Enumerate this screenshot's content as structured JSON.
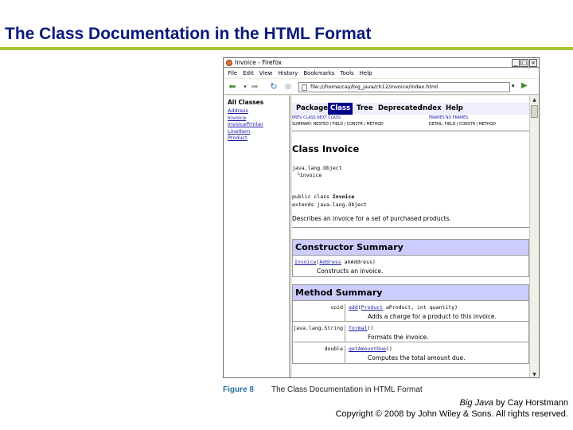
{
  "slide": {
    "title": "The Class Documentation in the HTML Format"
  },
  "browser": {
    "window_title": "Invoice - Firefox",
    "window_buttons": [
      "_",
      "□",
      "×"
    ],
    "menu": [
      "File",
      "Edit",
      "View",
      "History",
      "Bookmarks",
      "Tools",
      "Help"
    ],
    "nav_icons": [
      "back-arrow-icon",
      "forward-arrow-icon",
      "reload-icon",
      "stop-icon",
      "home-icon"
    ],
    "url": "file:///home/cay/big_java/ch12/invoice/index.html",
    "left_frame": {
      "heading": "All Classes",
      "classes": [
        "Address",
        "Invoice",
        "InvoicePrinter",
        "LineItem",
        "Product"
      ]
    },
    "content": {
      "nav_tabs": [
        "Package",
        "Class",
        "Tree",
        "Deprecated",
        "Index",
        "Help"
      ],
      "active_tab": "Class",
      "subnav_left_1": "PREV CLASS   NEXT CLASS",
      "subnav_left_2": "SUMMARY: NESTED | FIELD | CONSTR | METHOD",
      "subnav_right_1": "FRAMES   NO FRAMES",
      "subnav_right_2": "DETAIL: FIELD | CONSTR | METHOD",
      "class_title": "Class Invoice",
      "hierarchy_1": "java.lang.Object",
      "hierarchy_2": "└Invoice",
      "declaration_1": "public class Invoice",
      "declaration_2": "extends java.lang.Object",
      "description": "Describes an invoice for a set of purchased products.",
      "constructor_summary": {
        "heading": "Constructor Summary",
        "rows": [
          {
            "name": "Invoice",
            "params": "(Address anAddress)",
            "param_type": "Address",
            "desc": "Constructs an invoice."
          }
        ]
      },
      "method_summary": {
        "heading": "Method Summary",
        "rows": [
          {
            "type": "void",
            "name": "add",
            "sig_open": "(",
            "param_type": "Product",
            "sig_rest": " aProduct, int quantity)",
            "desc": "Adds a charge for a product to this invoice."
          },
          {
            "type": "java.lang.String",
            "name": "format",
            "sig_open": "()",
            "param_type": "",
            "sig_rest": "",
            "desc": "Formats the invoice."
          },
          {
            "type": "double",
            "name": "getAmountDue",
            "sig_open": "()",
            "param_type": "",
            "sig_rest": "",
            "desc": "Computes the total amount due."
          }
        ]
      }
    }
  },
  "caption": {
    "figure": "Figure 8",
    "text": "The Class Documentation in HTML Format"
  },
  "credit": {
    "book": "Big Java",
    "author": " by Cay Horstmann",
    "copyright": "Copyright © 2008 by John Wiley & Sons.  All rights reserved."
  }
}
